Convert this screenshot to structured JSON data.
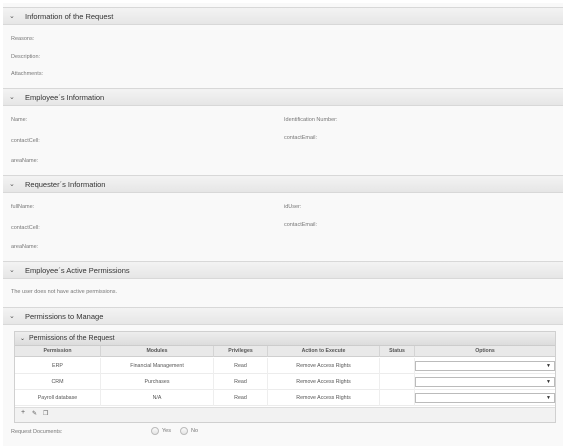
{
  "request_info": {
    "title": "Information of the Request",
    "reason_label": "Reasons:",
    "description_label": "Description:",
    "attachments_label": "Attachments:"
  },
  "employee_info": {
    "title": "Employee´s Information",
    "name_label": "Name:",
    "id_label": "Identification Number:",
    "cell_label": "contactCell:",
    "email_label": "contactEmail:",
    "area_label": "areaName:"
  },
  "requester_info": {
    "title": "Requester´s Information",
    "fullname_label": "fullName:",
    "iduser_label": "idUser:",
    "cell_label": "contactCell:",
    "email_label": "contactEmail:",
    "area_label": "areaName:"
  },
  "active_permissions": {
    "title": "Employee´s Active Permissions",
    "message": "The user does not have active permissions."
  },
  "permissions_manage": {
    "title": "Permissions to Manage"
  },
  "permissions_request": {
    "title": "Permissions of the Request",
    "columns": [
      "Permission",
      "Modules",
      "Privileges",
      "Action to Execute",
      "Status",
      "Options"
    ],
    "rows": [
      {
        "permission": "ERP",
        "module": "Financial Management",
        "privilege": "Read",
        "action": "Remove Access Rights",
        "status": "",
        "option": ""
      },
      {
        "permission": "CRM",
        "module": "Purchases",
        "privilege": "Read",
        "action": "Remove Access Rights",
        "status": "",
        "option": ""
      },
      {
        "permission": "Payroll database",
        "module": "N/A",
        "privilege": "Read",
        "action": "Remove Access Rights",
        "status": "",
        "option": ""
      }
    ]
  },
  "request_documents": {
    "label": "Request Documents:",
    "yes": "Yes",
    "no": "No"
  },
  "icons": {
    "chevron": "chevron-down-icon",
    "add": "plus-icon",
    "edit": "pencil-icon",
    "copy": "copy-icon",
    "select_arrow": "triangle-down-icon"
  }
}
